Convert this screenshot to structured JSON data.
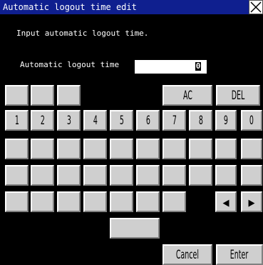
{
  "window": {
    "title": "Automatic logout time edit",
    "close_icon": "close-x-icon"
  },
  "prompt": "Input automatic logout time.",
  "field": {
    "label": "Automatic logout time",
    "value": "0"
  },
  "keypad": {
    "ac": "AC",
    "del": "DEL",
    "digits": [
      "1",
      "2",
      "3",
      "4",
      "5",
      "6",
      "7",
      "8",
      "9",
      "0"
    ],
    "left_arrow": "◀",
    "right_arrow": "▶",
    "cancel": "Cancel",
    "enter": "Enter"
  },
  "colors": {
    "titlebar": "#0f1f8f",
    "background": "#000000",
    "key_face": "#cfcfcf"
  }
}
